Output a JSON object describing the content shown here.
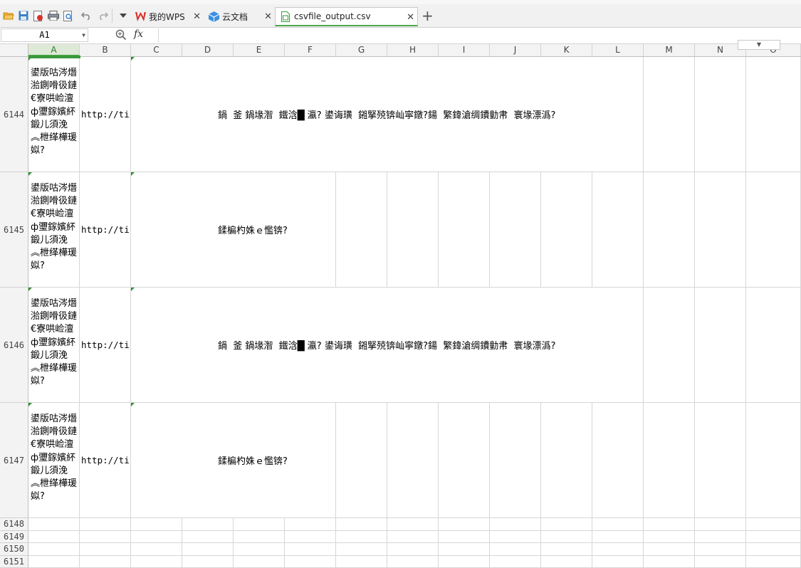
{
  "tabs": [
    {
      "label": "我的WPS",
      "icon": "wps-logo-icon"
    },
    {
      "label": "云文档",
      "icon": "cloud-cube-icon"
    },
    {
      "label": "csvfile_output.csv",
      "icon": "csv-file-icon",
      "active": true
    }
  ],
  "formula_bar": {
    "cell_ref": "A1",
    "fx": "fx",
    "content": ""
  },
  "columns": [
    "A",
    "B",
    "C",
    "D",
    "E",
    "F",
    "G",
    "H",
    "I",
    "J",
    "K",
    "L",
    "M",
    "N",
    "O"
  ],
  "rows": [
    {
      "num": "6144",
      "a": "鍙版咕涔熸湁鍘嗗彶鏈€寮哄崄澶ф瓕鎵嬪紑鍛儿須浼︽枻缂樺瑗姒?",
      "b": "http://ti",
      "c": "鍋  釜 鍋堟潪  鐵浛█ 瀛? 鍙诲璜  鎺掔殑锛屾寜鐓?鍚  繁鍏滄绸鐨勭帇  寰堟漂潙?"
    },
    {
      "num": "6145",
      "a": "鍙版咕涔熸湁鍘嗗彶鏈€寮哄崄澶ф瓕鎵嬪紑鍛儿須浼︽枻缂樺瑗姒?",
      "b": "http://ti",
      "c": "鍒楄杓姝ｅ懢锛?"
    },
    {
      "num": "6146",
      "a": "鍙版咕涔熸湁鍘嗗彶鏈€寮哄崄澶ф瓕鎵嬪紑鍛儿須浼︽枻缂樺瑗姒?",
      "b": "http://ti",
      "c": "鍋  釜 鍋堟潪  鐵浛█ 瀛? 鍙诲璜  鎺掔殑锛屾寜鐓?鍚  繁鍏滄绸鐨勭帇  寰堟漂潙?"
    },
    {
      "num": "6147",
      "a": "鍙版咕涔熸湁鍘嗗彶鏈€寮哄崄澶ф瓕鎵嬪紑鍛儿須浼︽枻缂樺瑗姒?",
      "b": "http://ti",
      "c": "鍒楄杓姝ｅ懢锛?"
    }
  ],
  "empty_rows": [
    "6148",
    "6149",
    "6150",
    "6151"
  ],
  "colors": {
    "accent": "#4aa84a",
    "wps_red": "#d9322b",
    "cloud_blue": "#3d8fe0"
  }
}
